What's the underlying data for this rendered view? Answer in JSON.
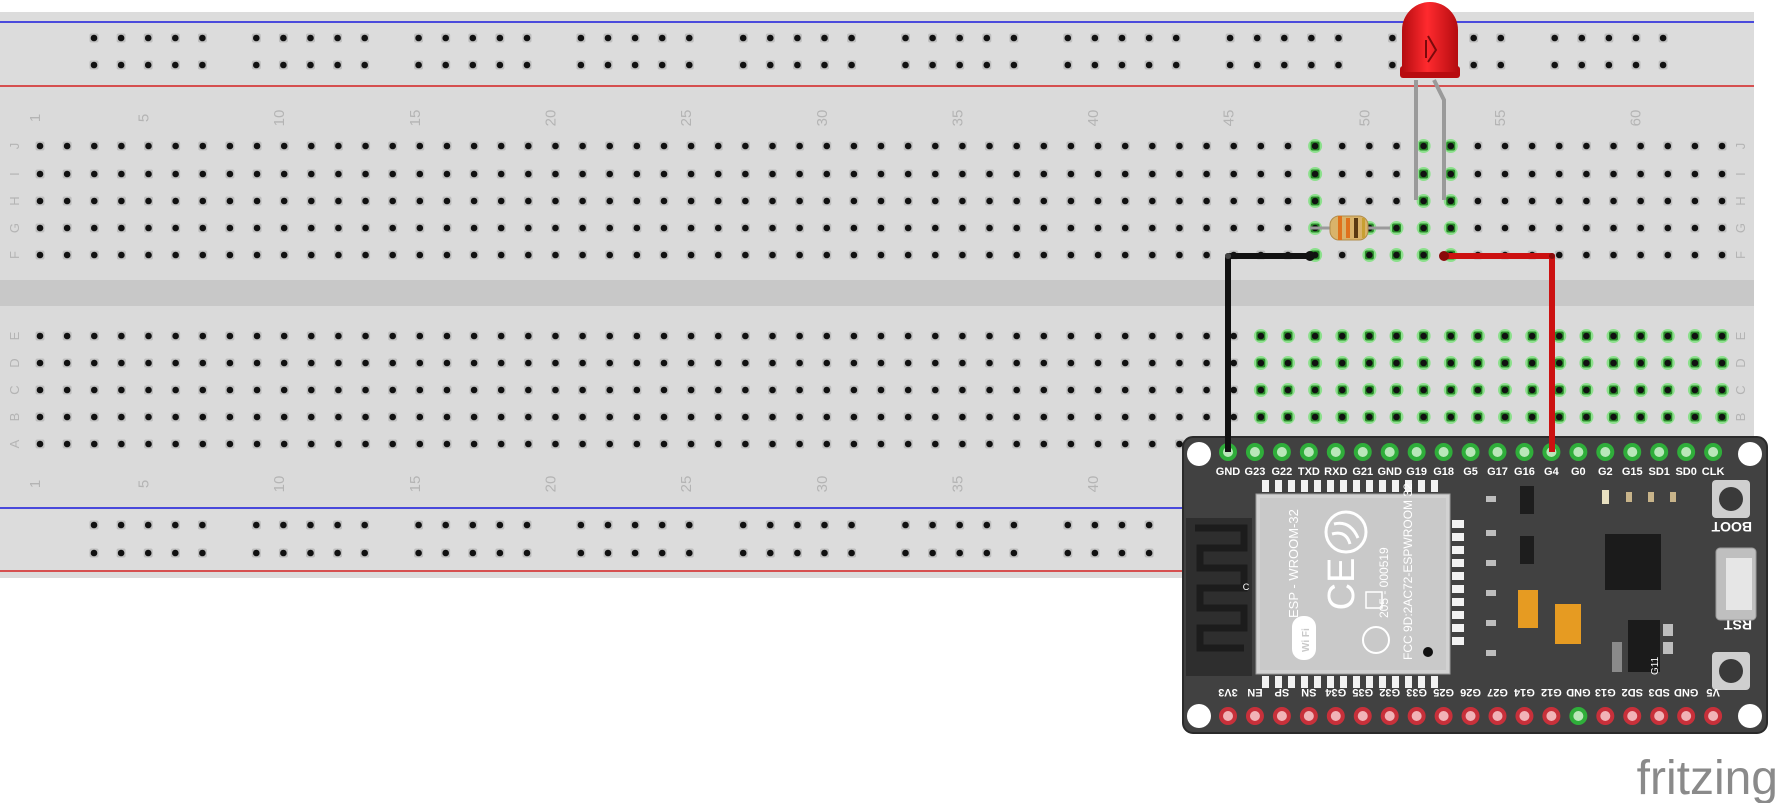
{
  "breadboard": {
    "column_numbers": [
      "1",
      "5",
      "10",
      "15",
      "20",
      "25",
      "30",
      "35",
      "40",
      "45",
      "50",
      "55",
      "60"
    ],
    "row_letters_top": [
      "J",
      "I",
      "H",
      "G",
      "F"
    ],
    "row_letters_bottom": [
      "E",
      "D",
      "C",
      "B",
      "A"
    ],
    "rail_colors": {
      "blue": "#1a1adb",
      "red": "#d42222"
    }
  },
  "esp32": {
    "top_pins": [
      "GND",
      "G23",
      "G22",
      "TXD",
      "RXD",
      "G21",
      "GND",
      "G19",
      "G18",
      "G5",
      "G17",
      "G16",
      "G4",
      "G0",
      "G2",
      "G15",
      "SD1",
      "SD0",
      "CLK"
    ],
    "bottom_pins": [
      "3V3",
      "EN",
      "SP",
      "SN",
      "G34",
      "G35",
      "G32",
      "G33",
      "G25",
      "G26",
      "G27",
      "G14",
      "G12",
      "GND",
      "G13",
      "SD2",
      "SD3",
      "GND",
      "V5"
    ],
    "module_name": "ESP - WROOM-32",
    "module_cert": "205 - 000519",
    "module_fcc": "FCC 9D:2AC72-ESPWROOM 32",
    "button_boot": "BOOT",
    "button_rst": "RST",
    "antenna_mark": "C",
    "wifi_logo": "Wi Fi",
    "chip_mark": "G11"
  },
  "components": {
    "led_color": "#e8141b",
    "resistor_body_color": "#d9b36a",
    "wire_gnd_color": "#111111",
    "wire_signal_color": "#cc1111"
  },
  "watermark": "fritzing"
}
